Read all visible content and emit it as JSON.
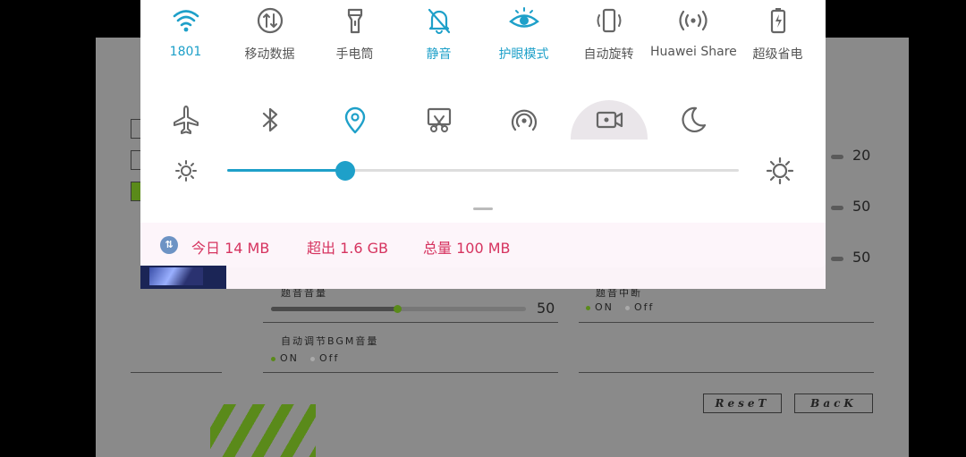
{
  "quick_tiles_row1": [
    {
      "id": "wifi",
      "icon": "wifi-icon",
      "label": "1801",
      "active": true
    },
    {
      "id": "mobile-data",
      "icon": "mobile-data-icon",
      "label": "移动数据",
      "active": false
    },
    {
      "id": "flashlight",
      "icon": "flashlight-icon",
      "label": "手电筒",
      "active": false
    },
    {
      "id": "mute",
      "icon": "bell-off-icon",
      "label": "静音",
      "active": true
    },
    {
      "id": "eye-comfort",
      "icon": "eye-icon",
      "label": "护眼模式",
      "active": true
    },
    {
      "id": "auto-rotate",
      "icon": "rotate-icon",
      "label": "自动旋转",
      "active": false
    },
    {
      "id": "huawei-share",
      "icon": "share-waves-icon",
      "label": "Huawei Share",
      "active": false
    },
    {
      "id": "power-saver",
      "icon": "battery-bolt-icon",
      "label": "超级省电",
      "active": false
    }
  ],
  "quick_tiles_row2": [
    {
      "id": "airplane",
      "icon": "airplane-icon",
      "active": false
    },
    {
      "id": "bluetooth",
      "icon": "bluetooth-icon",
      "active": false
    },
    {
      "id": "location",
      "icon": "location-pin-icon",
      "active": true
    },
    {
      "id": "screenshot",
      "icon": "scissors-screenshot-icon",
      "active": false
    },
    {
      "id": "hotspot",
      "icon": "hotspot-icon",
      "active": false
    },
    {
      "id": "screen-record",
      "icon": "video-camera-icon",
      "active": false
    },
    {
      "id": "dark-mode",
      "icon": "moon-icon",
      "active": false
    }
  ],
  "brightness": {
    "level": 0.23
  },
  "data_usage": {
    "icon": "data-arrows-icon",
    "today": "今日 14 MB",
    "exceeded": "超出 1.6 GB",
    "total": "总量 100 MB"
  },
  "colors": {
    "accent": "#1ea0c9",
    "data_text": "#d6335f",
    "game_green": "#5a8a1a"
  },
  "game": {
    "values": {
      "v1": "20",
      "v2": "50",
      "v3": "50",
      "v4": "50"
    },
    "bgm_volume_label": "题音音量",
    "right_label": "题音中断",
    "auto_bgm_label": "自动调节BGM音量",
    "on": "ON",
    "off": "Off",
    "reset": "ReseT",
    "back": "BacK"
  }
}
